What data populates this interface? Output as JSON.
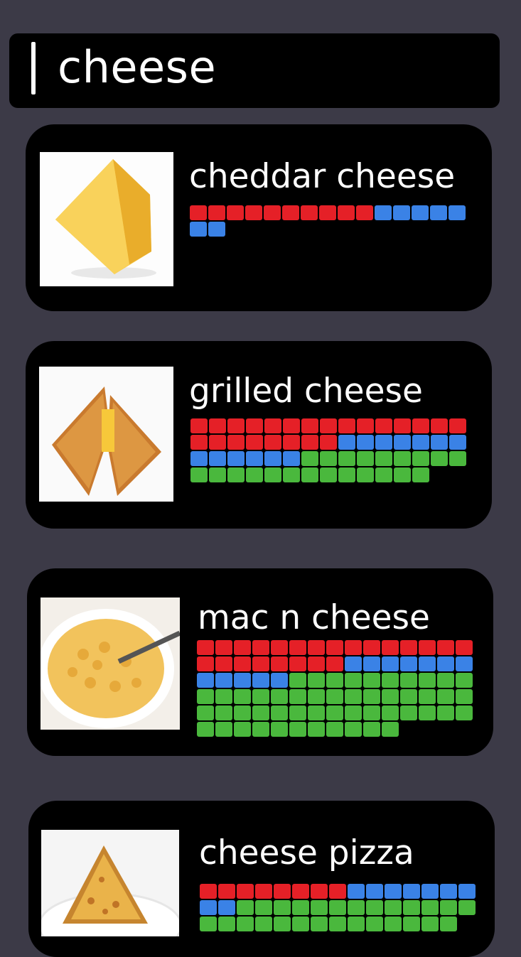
{
  "search": {
    "value": "cheese"
  },
  "colors": {
    "red": "#e52027",
    "blue": "#3a82e6",
    "green": "#4ab83d"
  },
  "results": [
    {
      "title": "cheddar cheese",
      "image_icon": "cheddar-cheese-image",
      "red": 10,
      "blue": 7,
      "green": 0
    },
    {
      "title": "grilled cheese",
      "image_icon": "grilled-cheese-image",
      "red": 23,
      "blue": 13,
      "green": 22
    },
    {
      "title": "mac n cheese",
      "image_icon": "mac-n-cheese-image",
      "red": 23,
      "blue": 12,
      "green": 51
    },
    {
      "title": "cheese pizza",
      "image_icon": "cheese-pizza-image",
      "red": 8,
      "blue": 9,
      "green": 27
    }
  ]
}
